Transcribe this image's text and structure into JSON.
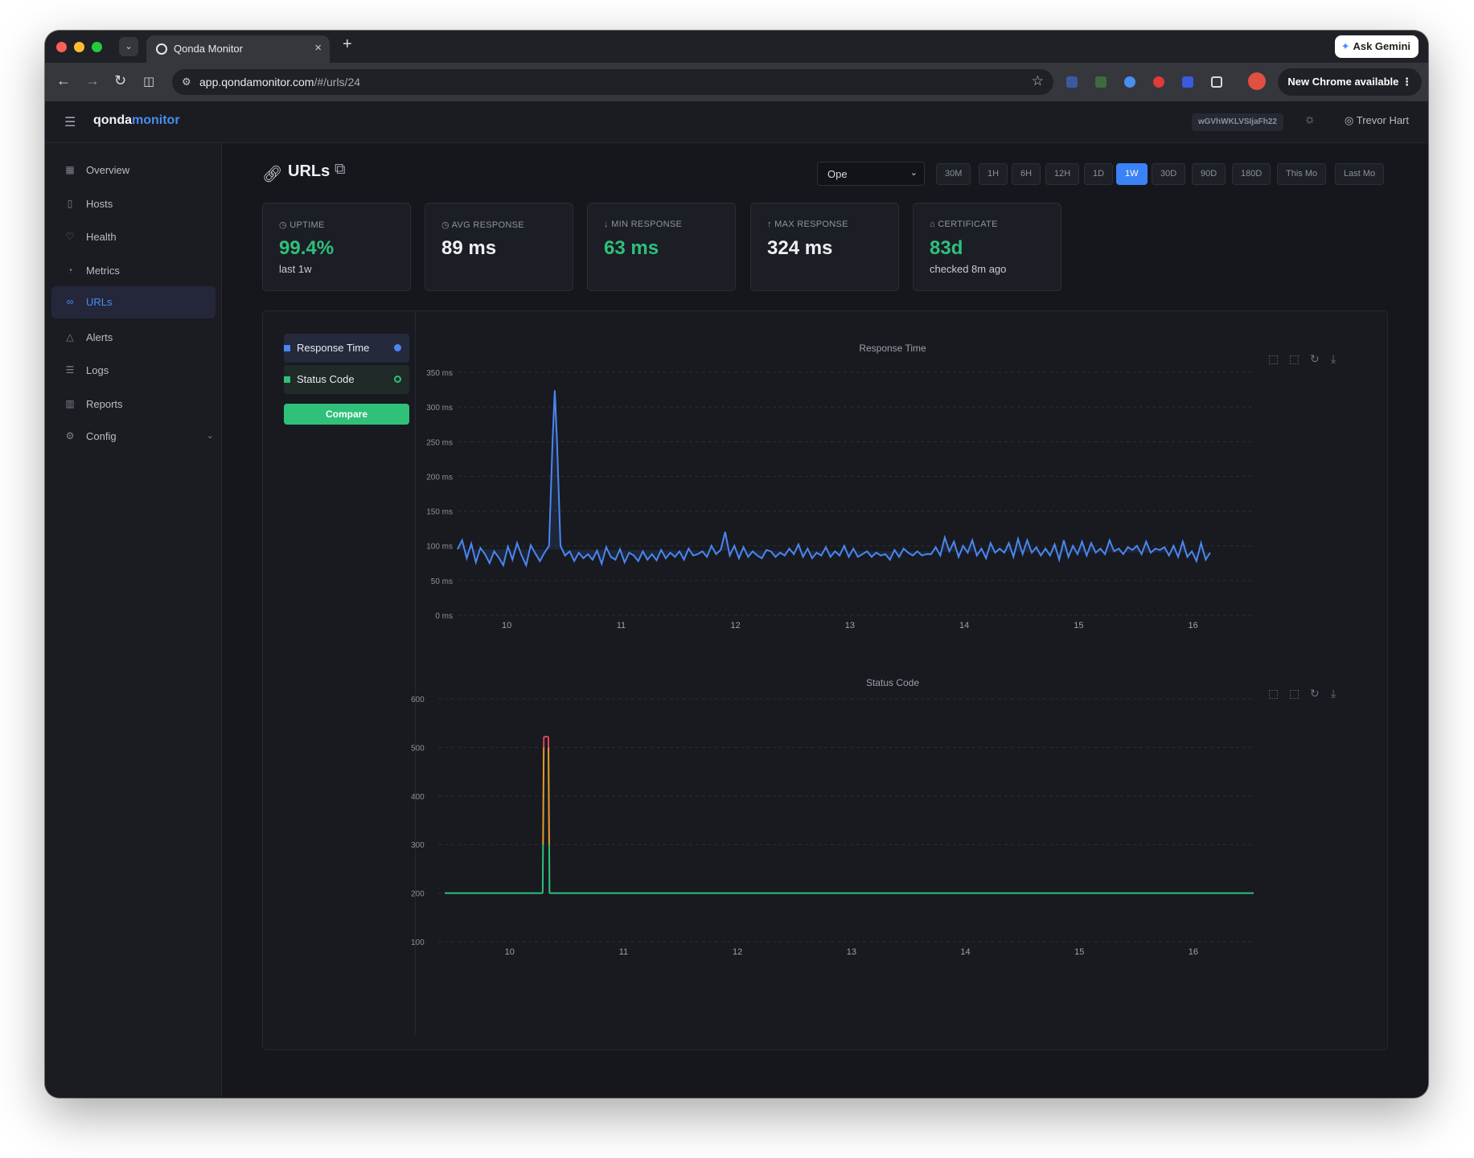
{
  "browser": {
    "tab_title": "Qonda Monitor",
    "url_host": "app.qondamonitor.com",
    "url_path": "/#/urls/24",
    "ask_gemini": "Ask Gemini",
    "new_chrome": "New Chrome available"
  },
  "header": {
    "logo_main": "qonda",
    "logo_accent": "monitor",
    "token": "wGVhWKLVSIjaFh22",
    "user_name": "Trevor Hart"
  },
  "sidebar": {
    "items": [
      {
        "label": "Overview",
        "icon": "grid-icon"
      },
      {
        "label": "Hosts",
        "icon": "server-icon"
      },
      {
        "label": "Health",
        "icon": "heart-icon"
      },
      {
        "label": "Metrics",
        "icon": "gauge-icon"
      },
      {
        "label": "URLs",
        "icon": "link-icon",
        "active": true
      },
      {
        "label": "Alerts",
        "icon": "bell-icon"
      },
      {
        "label": "Logs",
        "icon": "list-icon"
      },
      {
        "label": "Reports",
        "icon": "bar-chart-icon"
      },
      {
        "label": "Config",
        "icon": "gear-icon"
      }
    ]
  },
  "page": {
    "title": "URLs",
    "select_value": "Ope",
    "ranges": [
      "30M",
      "1H",
      "6H",
      "12H",
      "1D",
      "1W",
      "30D",
      "90D",
      "180D",
      "This Mo",
      "Last Mo"
    ],
    "active_range": "1W"
  },
  "stats": [
    {
      "label": "UPTIME",
      "value": "99.4%",
      "sub": "last 1w",
      "good": true
    },
    {
      "label": "AVG RESPONSE",
      "value": "89 ms",
      "sub": "",
      "good": false
    },
    {
      "label": "MIN RESPONSE",
      "value": "63 ms",
      "sub": "",
      "good": true
    },
    {
      "label": "MAX RESPONSE",
      "value": "324 ms",
      "sub": "",
      "good": false
    },
    {
      "label": "CERTIFICATE",
      "value": "83d",
      "sub": "checked 8m ago",
      "good": true
    }
  ],
  "legend": {
    "response_time": "Response Time",
    "status_code": "Status Code",
    "compare": "Compare"
  },
  "colors": {
    "accent": "#3b82f6",
    "good": "#2fc07a",
    "line_blue": "#4a86f0",
    "warn_orange": "#e39b2d",
    "error_red": "#e0455a"
  },
  "chart_data": [
    {
      "type": "area",
      "title": "Response Time",
      "xlabel": "",
      "ylabel": "",
      "x_ticks": [
        "10",
        "11",
        "12",
        "13",
        "14",
        "15",
        "16"
      ],
      "y_ticks": [
        "0 ms",
        "50 ms",
        "100 ms",
        "150 ms",
        "200 ms",
        "250 ms",
        "300 ms",
        "350 ms"
      ],
      "ylim": [
        0,
        350
      ],
      "xlim": [
        9.57,
        16.53
      ],
      "x": [
        9.57,
        9.61,
        9.65,
        9.69,
        9.73,
        9.77,
        9.81,
        9.85,
        9.89,
        9.93,
        9.97,
        10.01,
        10.05,
        10.09,
        10.13,
        10.17,
        10.21,
        10.25,
        10.29,
        10.33,
        10.37,
        10.4,
        10.42,
        10.44,
        10.47,
        10.51,
        10.55,
        10.59,
        10.63,
        10.67,
        10.71,
        10.75,
        10.79,
        10.83,
        10.87,
        10.91,
        10.95,
        10.99,
        11.03,
        11.07,
        11.11,
        11.15,
        11.19,
        11.23,
        11.27,
        11.31,
        11.35,
        11.39,
        11.43,
        11.47,
        11.51,
        11.55,
        11.59,
        11.63,
        11.67,
        11.71,
        11.75,
        11.79,
        11.83,
        11.87,
        11.91,
        11.95,
        11.99,
        12.03,
        12.07,
        12.11,
        12.15,
        12.19,
        12.23,
        12.27,
        12.31,
        12.35,
        12.39,
        12.43,
        12.47,
        12.51,
        12.55,
        12.59,
        12.63,
        12.67,
        12.71,
        12.75,
        12.79,
        12.83,
        12.87,
        12.91,
        12.95,
        12.99,
        13.03,
        13.07,
        13.11,
        13.15,
        13.19,
        13.23,
        13.27,
        13.31,
        13.35,
        13.39,
        13.43,
        13.47,
        13.51,
        13.55,
        13.59,
        13.63,
        13.67,
        13.71,
        13.75,
        13.79,
        13.83,
        13.87,
        13.91,
        13.95,
        13.99,
        14.03,
        14.07,
        14.11,
        14.15,
        14.19,
        14.23,
        14.27,
        14.31,
        14.35,
        14.39,
        14.43,
        14.47,
        14.51,
        14.55,
        14.59,
        14.63,
        14.67,
        14.71,
        14.75,
        14.79,
        14.83,
        14.87,
        14.91,
        14.95,
        14.99,
        15.03,
        15.07,
        15.11,
        15.15,
        15.19,
        15.23,
        15.27,
        15.31,
        15.35,
        15.39,
        15.43,
        15.47,
        15.51,
        15.55,
        15.59,
        15.63,
        15.67,
        15.71,
        15.75,
        15.79,
        15.83,
        15.87,
        15.91,
        15.95,
        15.99,
        16.03,
        16.07,
        16.11,
        16.15,
        16.19,
        16.23,
        16.27,
        16.31,
        16.35,
        16.39,
        16.43,
        16.47,
        16.53
      ],
      "series": [
        {
          "values": [
            95,
            108,
            82,
            103,
            76,
            97,
            88,
            75,
            92,
            83,
            72,
            99,
            80,
            104,
            86,
            72,
            101,
            89,
            78,
            90,
            100,
            250,
            324,
            250,
            100,
            86,
            92,
            78,
            90,
            82,
            88,
            80,
            93,
            74,
            98,
            84,
            80,
            95,
            76,
            90,
            86,
            78,
            92,
            80,
            88,
            79,
            94,
            82,
            90,
            84,
            92,
            80,
            96,
            86,
            88,
            92,
            84,
            100,
            88,
            94,
            120,
            86,
            100,
            82,
            98,
            84,
            92,
            86,
            82,
            94,
            92,
            84,
            90,
            86,
            96,
            88,
            102,
            84,
            96,
            82,
            90,
            86,
            98,
            84,
            92,
            86,
            100,
            84,
            96,
            84,
            88,
            92,
            84,
            90,
            86,
            88,
            80,
            94,
            84,
            96,
            90,
            86,
            92,
            86,
            88,
            88,
            98,
            86,
            112,
            92,
            106,
            84,
            100,
            90,
            108,
            86,
            96,
            82,
            104,
            90,
            96,
            90,
            104,
            84,
            110,
            88,
            108,
            90,
            98,
            86,
            96,
            86,
            102,
            80,
            108,
            84,
            100,
            88,
            106,
            86,
            104,
            90,
            96,
            88,
            108,
            92,
            96,
            88,
            98,
            94,
            100,
            88,
            106,
            90,
            96,
            94,
            98,
            86,
            100,
            84,
            106,
            84,
            92,
            78,
            104,
            80,
            90
          ]
        }
      ]
    },
    {
      "type": "line",
      "title": "Status Code",
      "xlabel": "",
      "ylabel": "",
      "x_ticks": [
        "10",
        "11",
        "12",
        "13",
        "14",
        "15",
        "16"
      ],
      "y_ticks": [
        "100",
        "200",
        "300",
        "400",
        "500",
        "600"
      ],
      "ylim": [
        100,
        600
      ],
      "xlim": [
        9.43,
        16.53
      ],
      "series": [
        {
          "x": [
            9.43,
            10.29,
            10.3,
            10.34,
            10.35,
            16.53
          ],
          "values": [
            200,
            200,
            522,
            522,
            200,
            200
          ]
        }
      ]
    }
  ]
}
